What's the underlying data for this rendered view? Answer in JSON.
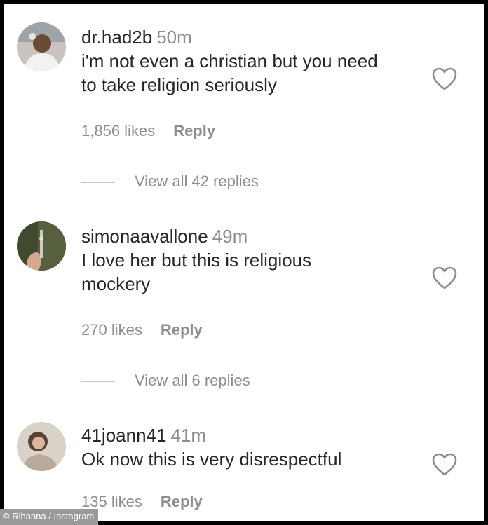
{
  "comments": [
    {
      "username": "dr.had2b",
      "time": "50m",
      "text": "i'm not even a christian but you need to take religion seriously",
      "likes": "1,856 likes",
      "reply": "Reply",
      "view_replies": "View all 42 replies",
      "avatar_icon": "avatar-photo",
      "heart_icon": "heart-outline-icon"
    },
    {
      "username": "simonaavallone",
      "time": "49m",
      "text": "I love her but this is religious mockery",
      "likes": "270 likes",
      "reply": "Reply",
      "view_replies": "View all 6 replies",
      "avatar_icon": "avatar-photo",
      "heart_icon": "heart-outline-icon"
    },
    {
      "username": "41joann41",
      "time": "41m",
      "text": "Ok now this is very disrespectful",
      "likes": "135 likes",
      "reply": "Reply",
      "avatar_icon": "avatar-photo",
      "heart_icon": "heart-outline-icon"
    }
  ],
  "credit": "© Rihanna / Instagram"
}
